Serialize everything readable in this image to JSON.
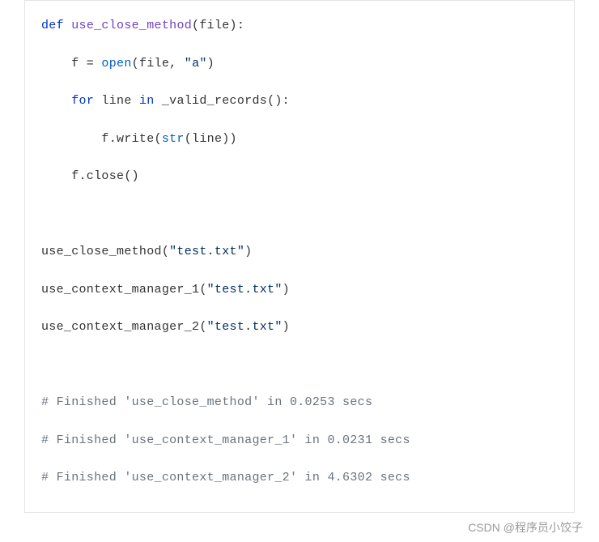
{
  "code": {
    "l1_def": "def",
    "l1_fn": "use_close_method",
    "l1_rest": "(file):",
    "l2_pre": "    f = ",
    "l2_open": "open",
    "l2_mid": "(file, ",
    "l2_str": "\"a\"",
    "l2_end": ")",
    "l3_pre": "    ",
    "l3_for": "for",
    "l3_mid1": " line ",
    "l3_in": "in",
    "l3_mid2": " _valid_records():",
    "l4_pre": "        f.write(",
    "l4_str": "str",
    "l4_end": "(line))",
    "l5": "    f.close()",
    "l6_fn": "use_close_method(",
    "l6_str": "\"test.txt\"",
    "l6_end": ")",
    "l7_fn": "use_context_manager_1(",
    "l7_str": "\"test.txt\"",
    "l7_end": ")",
    "l8_fn": "use_context_manager_2(",
    "l8_str": "\"test.txt\"",
    "l8_end": ")",
    "c1": "# Finished 'use_close_method' in 0.0253 secs",
    "c2": "# Finished 'use_context_manager_1' in 0.0231 secs",
    "c3": "# Finished 'use_context_manager_2' in 4.6302 secs"
  },
  "attribution": "CSDN @程序员小饺子"
}
